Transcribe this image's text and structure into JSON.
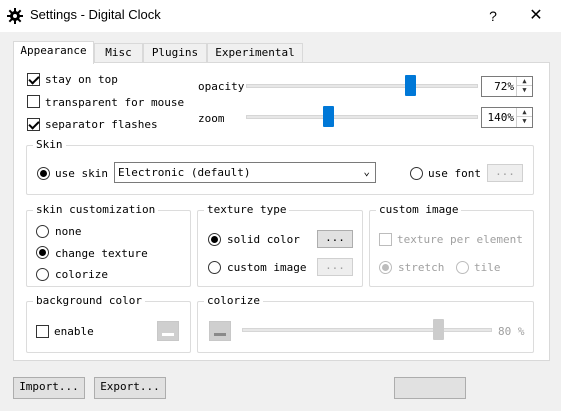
{
  "window": {
    "title": "Settings - Digital Clock",
    "help": "?",
    "close": "✕"
  },
  "tabs": [
    {
      "label": "Appearance",
      "active": true
    },
    {
      "label": "Misc",
      "active": false
    },
    {
      "label": "Plugins",
      "active": false
    },
    {
      "label": "Experimental",
      "active": false
    }
  ],
  "appearance": {
    "stay_on_top": {
      "label": "stay on top",
      "checked": true
    },
    "transparent_for_mouse": {
      "label": "transparent for mouse",
      "checked": false
    },
    "separator_flashes": {
      "label": "separator flashes",
      "checked": true
    },
    "opacity": {
      "label": "opacity",
      "value": "72%",
      "level": 0.72
    },
    "zoom": {
      "label": "zoom",
      "value": "140%",
      "level": 0.35
    }
  },
  "skin": {
    "title": "Skin",
    "use_skin_label": "use skin",
    "use_skin_selected": true,
    "skin_value": "Electronic (default)",
    "use_font_label": "use font",
    "use_font_selected": false,
    "font_button": "..."
  },
  "skin_customization": {
    "title": "skin customization",
    "options": [
      {
        "label": "none",
        "selected": false
      },
      {
        "label": "change texture",
        "selected": true
      },
      {
        "label": "colorize",
        "selected": false
      }
    ]
  },
  "texture_type": {
    "title": "texture type",
    "solid_color": {
      "label": "solid color",
      "selected": true,
      "button": "..."
    },
    "custom_image": {
      "label": "custom image",
      "selected": false,
      "button": "..."
    }
  },
  "custom_image": {
    "title": "custom image",
    "texture_per_element": {
      "label": "texture per element",
      "checked": false
    },
    "stretch": {
      "label": "stretch",
      "selected": true
    },
    "tile": {
      "label": "tile",
      "selected": false
    }
  },
  "background_color": {
    "title": "background color",
    "enable": {
      "label": "enable",
      "checked": false
    }
  },
  "colorize": {
    "title": "colorize",
    "value": "80 %",
    "level": 0.8
  },
  "buttons": {
    "import": "Import...",
    "export": "Export..."
  },
  "colors": {
    "accent": "#0078d7",
    "panel": "#ffffff",
    "window": "#f0f0f0"
  }
}
